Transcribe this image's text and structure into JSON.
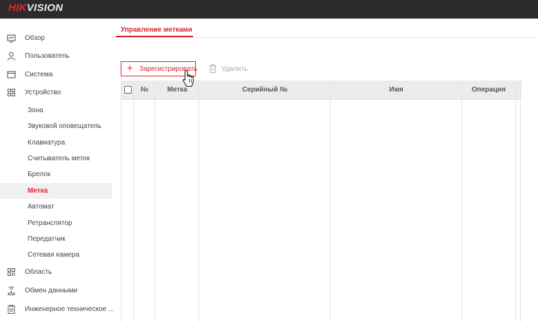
{
  "header": {
    "logo_red": "HIK",
    "logo_rest": "VISION"
  },
  "sidebar": {
    "items": [
      {
        "label": "Обзор",
        "icon": "monitor-icon"
      },
      {
        "label": "Пользователь",
        "icon": "user-icon"
      },
      {
        "label": "Система",
        "icon": "window-icon"
      },
      {
        "label": "Устройство",
        "icon": "device-grid-icon"
      }
    ],
    "subitems": [
      {
        "label": "Зона"
      },
      {
        "label": "Звуковой оповещатель"
      },
      {
        "label": "Клавиатура"
      },
      {
        "label": "Считыватель меток"
      },
      {
        "label": "Брелок"
      },
      {
        "label": "Метка",
        "active": true
      },
      {
        "label": "Автомат"
      },
      {
        "label": "Ретранслятор"
      },
      {
        "label": "Передатчик"
      },
      {
        "label": "Сетевая камера"
      }
    ],
    "bottom_items": [
      {
        "label": "Область",
        "icon": "area-icon"
      },
      {
        "label": "Обмен данными",
        "icon": "data-exchange-icon"
      },
      {
        "label": "Инженерное техническое ...",
        "icon": "maintenance-icon"
      }
    ]
  },
  "main": {
    "tab_label": "Управление метками",
    "toolbar": {
      "register_label": "Зарегистрировать",
      "delete_label": "Удалить"
    },
    "table": {
      "columns": [
        "№",
        "Метка",
        "Серийный №",
        "Имя",
        "Операция"
      ],
      "rows": []
    }
  },
  "colors": {
    "accent": "#d7232d",
    "header_bg": "#2b2b2b",
    "table_header_bg": "#ececec"
  }
}
